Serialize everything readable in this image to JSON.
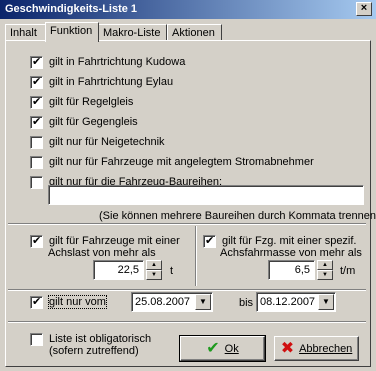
{
  "window": {
    "title": "Geschwindigkeits-Liste 1",
    "close_glyph": "×"
  },
  "tabs": [
    {
      "label": "Inhalt"
    },
    {
      "label": "Funktion"
    },
    {
      "label": "Makro-Liste"
    },
    {
      "label": "Aktionen"
    }
  ],
  "checks": [
    {
      "label": "gilt in Fahrtrichtung Kudowa",
      "checked": true
    },
    {
      "label": "gilt in Fahrtrichtung Eylau",
      "checked": true
    },
    {
      "label": "gilt für Regelgleis",
      "checked": true
    },
    {
      "label": "gilt für Gegengleis",
      "checked": true
    },
    {
      "label": "gilt nur für Neigetechnik",
      "checked": false
    },
    {
      "label": "gilt nur für Fahrzeuge mit angelegtem Stromabnehmer",
      "checked": false
    },
    {
      "label": "gilt nur für die Fahrzeug-Baureihen:",
      "checked": false
    }
  ],
  "baureihen": {
    "value": "",
    "hint": "(Sie können mehrere Baureihen durch Kommata trennen)"
  },
  "achslast": {
    "label1": "gilt für Fahrzeuge mit einer",
    "label2": "Achslast von mehr als",
    "value": "22,5",
    "unit": "t",
    "checked": true
  },
  "achsfahrmasse": {
    "label1": "gilt für Fzg. mit einer spezif.",
    "label2": "Achsfahrmasse von mehr als",
    "value": "6,5",
    "unit": "t/m",
    "checked": true
  },
  "datum": {
    "label": "gilt nur vom",
    "from": "25.08.2007",
    "to_label": "bis",
    "to": "08.12.2007",
    "checked": true
  },
  "obligatorisch": {
    "label1": "Liste ist obligatorisch",
    "label2": "(sofern zutreffend)",
    "checked": false
  },
  "buttons": {
    "ok": "Ok",
    "cancel": "Abbrechen"
  },
  "colors": {
    "ok_check": "#1e9a1e",
    "cancel_x": "#d01010"
  }
}
